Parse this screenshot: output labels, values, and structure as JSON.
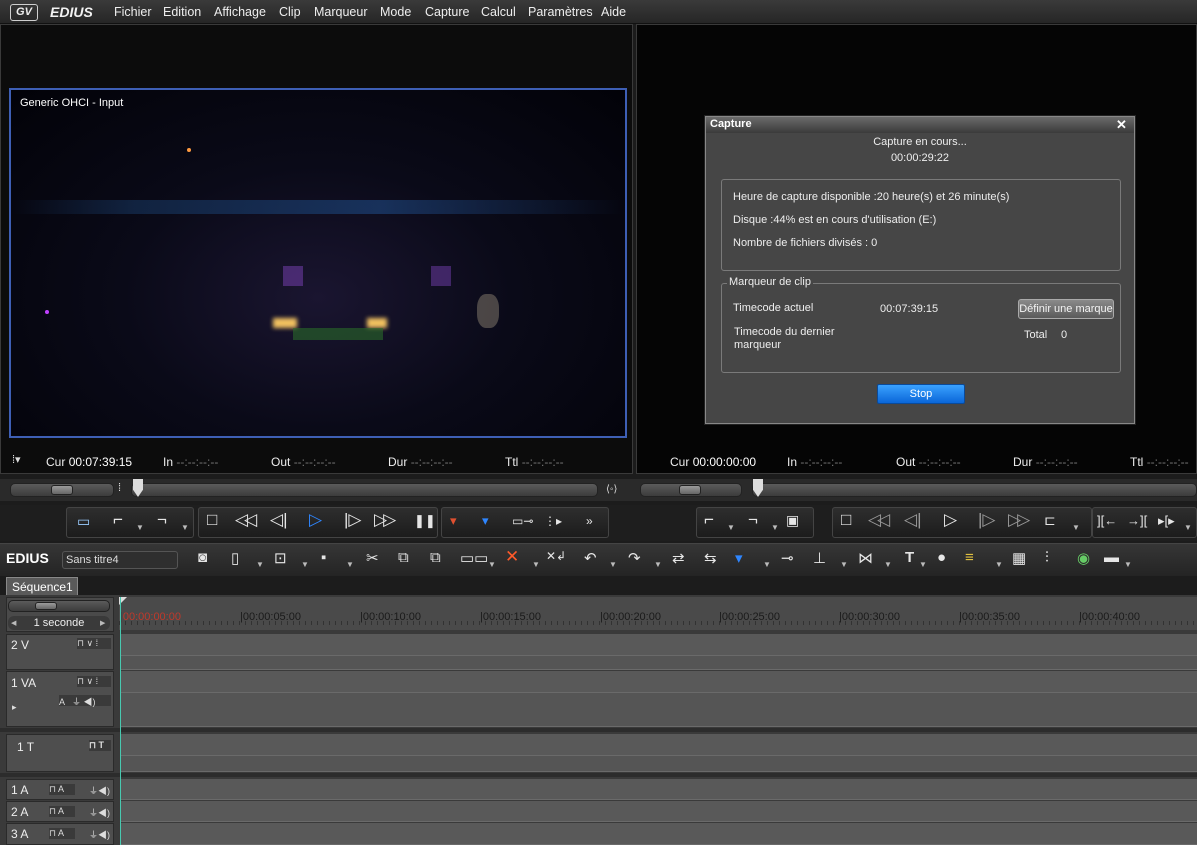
{
  "menubar": {
    "app_name": "EDIUS",
    "items": [
      "Fichier",
      "Edition",
      "Affichage",
      "Clip",
      "Marqueur",
      "Mode",
      "Capture",
      "Calcul",
      "Paramètres",
      "Aide"
    ]
  },
  "player": {
    "source_label": "Generic OHCI - Input",
    "cur_label": "Cur",
    "cur_value": "00:07:39:15",
    "in_label": "In",
    "in_value": "--:--:--:--",
    "out_label": "Out",
    "out_value": "--:--:--:--",
    "dur_label": "Dur",
    "dur_value": "--:--:--:--",
    "ttl_label": "Ttl",
    "ttl_value": "--:--:--:--"
  },
  "recorder": {
    "cur_label": "Cur",
    "cur_value": "00:00:00:00",
    "in_label": "In",
    "in_value": "--:--:--:--",
    "out_label": "Out",
    "out_value": "--:--:--:--",
    "dur_label": "Dur",
    "dur_value": "--:--:--:--",
    "ttl_label": "Ttl",
    "ttl_value": "--:--:--:--"
  },
  "capture_dialog": {
    "title": "Capture",
    "status": "Capture en cours...",
    "elapsed": "00:00:29:22",
    "available_time": "Heure de capture disponible :20 heure(s) et 26 minute(s)",
    "disk": "Disque :44% est en cours d'utilisation (E:)",
    "split_files": "Nombre de fichiers divisés : 0",
    "clip_marker_group": "Marqueur de clip",
    "current_tc_label": "Timecode actuel",
    "current_tc_value": "00:07:39:15",
    "define_mark_button": "Définir une marque",
    "last_marker_label": "Timecode du dernier marqueur",
    "total_label": "Total",
    "total_value": "0",
    "stop_button": "Stop"
  },
  "toolbar": {
    "app_label": "EDIUS",
    "project_name": "Sans titre4"
  },
  "timeline": {
    "sequence_tab": "Séquence1",
    "scale": "1 seconde",
    "ruler_ticks": [
      "00:00:00:00",
      "00:00:05:00",
      "00:00:10:00",
      "00:00:15:00",
      "00:00:20:00",
      "00:00:25:00",
      "00:00:30:00",
      "00:00:35:00",
      "00:00:40:00"
    ],
    "tracks": [
      {
        "name": "2 V"
      },
      {
        "name": "1 VA"
      },
      {
        "name": "1 T"
      },
      {
        "name": "1 A"
      },
      {
        "name": "2 A"
      },
      {
        "name": "3 A"
      }
    ]
  },
  "colors": {
    "accent_blue": "#1e7ae8",
    "video_border": "#3e5fb5",
    "playhead_tc": "#c0392b"
  }
}
